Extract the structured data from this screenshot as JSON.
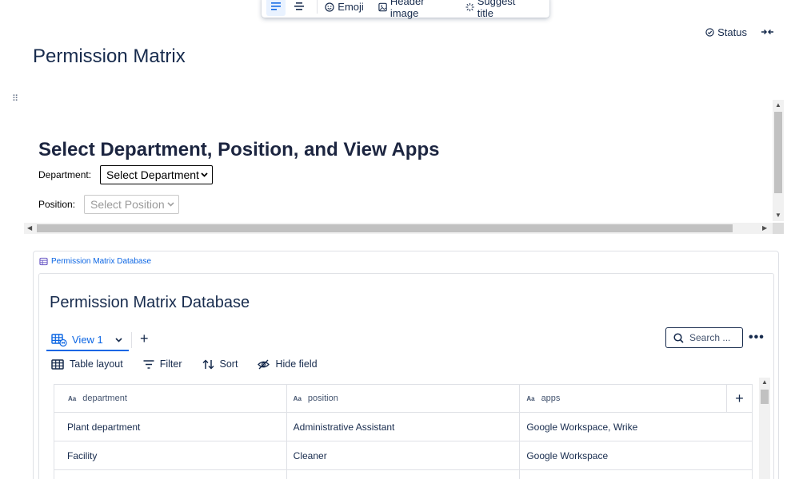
{
  "toolbar": {
    "emoji_label": "Emoji",
    "header_image_label": "Header image",
    "suggest_title_label": "Suggest title"
  },
  "status": {
    "label": "Status"
  },
  "page": {
    "title": "Permission Matrix"
  },
  "embed": {
    "heading": "Select Department, Position, and View Apps",
    "department_label": "Department:",
    "department_value": "Select Department",
    "position_label": "Position:",
    "position_value": "Select Position"
  },
  "database": {
    "link_label": "Permission Matrix Database",
    "title": "Permission Matrix Database",
    "view_tab": "View 1",
    "search_placeholder": "Search ...",
    "tools": {
      "table_layout": "Table layout",
      "filter": "Filter",
      "sort": "Sort",
      "hide_field": "Hide field"
    },
    "columns": [
      "department",
      "position",
      "apps"
    ],
    "rows": [
      [
        "Plant department",
        "Administrative Assistant",
        "Google Workspace, Wrike"
      ],
      [
        "Facility",
        "Cleaner",
        "Google Workspace"
      ]
    ]
  },
  "colors": {
    "accent": "#0c66e4",
    "text": "#172b4d"
  }
}
